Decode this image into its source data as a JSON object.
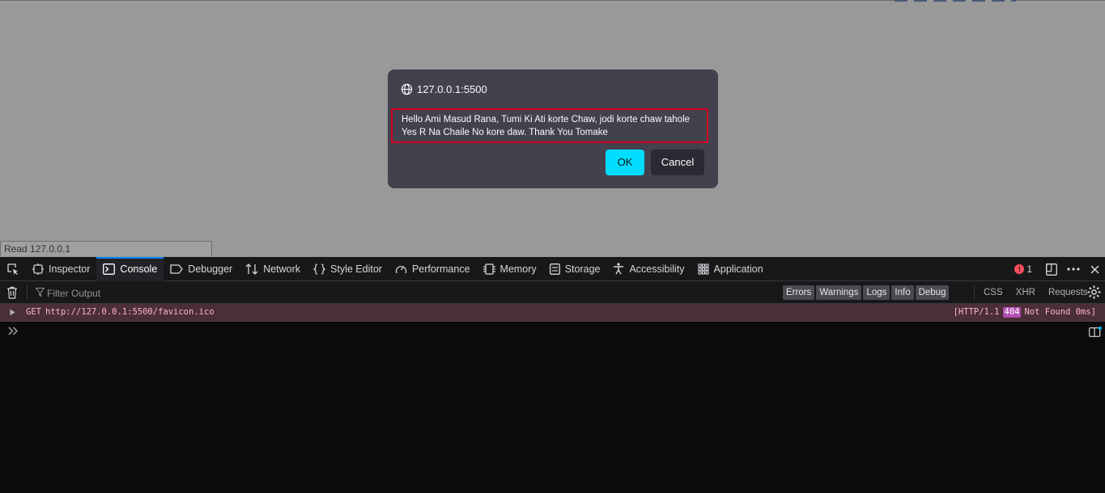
{
  "viewport": {
    "status_text": "Read 127.0.0.1"
  },
  "dialog": {
    "origin": "127.0.0.1:5500",
    "message_line1": "Hello Ami Masud Rana, Tumi Ki Ati korte Chaw, jodi korte chaw tahole",
    "message_line2": "Yes R Na Chaile No kore daw. Thank You Tomake",
    "ok_label": "OK",
    "cancel_label": "Cancel",
    "origin_icon": "globe-icon"
  },
  "devtools": {
    "tabs": [
      {
        "label": "Inspector",
        "icon": "inspector-icon"
      },
      {
        "label": "Console",
        "icon": "console-icon",
        "active": true
      },
      {
        "label": "Debugger",
        "icon": "debugger-icon"
      },
      {
        "label": "Network",
        "icon": "network-icon"
      },
      {
        "label": "Style Editor",
        "icon": "style-editor-icon"
      },
      {
        "label": "Performance",
        "icon": "performance-icon"
      },
      {
        "label": "Memory",
        "icon": "memory-icon"
      },
      {
        "label": "Storage",
        "icon": "storage-icon"
      },
      {
        "label": "Accessibility",
        "icon": "accessibility-icon"
      },
      {
        "label": "Application",
        "icon": "application-icon"
      }
    ],
    "error_count": "1",
    "filter_placeholder": "Filter Output",
    "levels": [
      "Errors",
      "Warnings",
      "Logs",
      "Info",
      "Debug"
    ],
    "types": [
      "CSS",
      "XHR",
      "Requests"
    ],
    "log": {
      "method": "GET",
      "url": "http://127.0.0.1:5500/favicon.ico",
      "status_prefix": "[HTTP/1.1",
      "status_code": "404",
      "status_suffix": "Not Found 0ms]"
    },
    "colors": {
      "accent": "#0a84ff",
      "error_row_bg": "#4b2f36",
      "ok_button": "#00ddff"
    }
  }
}
